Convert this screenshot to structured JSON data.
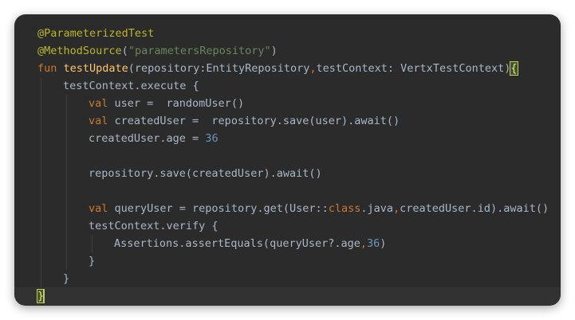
{
  "editor": {
    "lines": [
      {
        "indent": 0,
        "tokens": [
          {
            "t": "@ParameterizedTest",
            "c": "ann"
          }
        ]
      },
      {
        "indent": 0,
        "tokens": [
          {
            "t": "@MethodSource",
            "c": "ann"
          },
          {
            "t": "(",
            "c": ""
          },
          {
            "t": "\"parametersRepository\"",
            "c": "str"
          },
          {
            "t": ")",
            "c": ""
          }
        ]
      },
      {
        "indent": 0,
        "tokens": [
          {
            "t": "fun ",
            "c": "kw"
          },
          {
            "t": "testUpdate",
            "c": "fn"
          },
          {
            "t": "(repository:EntityRepository",
            "c": ""
          },
          {
            "t": ",",
            "c": "kw"
          },
          {
            "t": "testContext: VertxTestContext)",
            "c": ""
          },
          {
            "t": "{",
            "c": "brace-match"
          }
        ]
      },
      {
        "indent": 1,
        "tokens": [
          {
            "t": "testContext.execute {",
            "c": ""
          }
        ]
      },
      {
        "indent": 2,
        "tokens": [
          {
            "t": "val ",
            "c": "kw"
          },
          {
            "t": "user =  randomUser()",
            "c": ""
          }
        ]
      },
      {
        "indent": 2,
        "tokens": [
          {
            "t": "val ",
            "c": "kw"
          },
          {
            "t": "createdUser =  repository.save(user).await()",
            "c": ""
          }
        ]
      },
      {
        "indent": 2,
        "tokens": [
          {
            "t": "createdUser.age = ",
            "c": ""
          },
          {
            "t": "36",
            "c": "num"
          }
        ]
      },
      {
        "indent": 2,
        "tokens": []
      },
      {
        "indent": 2,
        "tokens": [
          {
            "t": "repository.save(createdUser).await()",
            "c": ""
          }
        ]
      },
      {
        "indent": 2,
        "tokens": []
      },
      {
        "indent": 2,
        "tokens": [
          {
            "t": "val ",
            "c": "kw"
          },
          {
            "t": "queryUser = repository.get(User::",
            "c": ""
          },
          {
            "t": "class",
            "c": "kw"
          },
          {
            "t": ".java",
            "c": ""
          },
          {
            "t": ",",
            "c": "kw"
          },
          {
            "t": "createdUser.id).await()",
            "c": ""
          }
        ]
      },
      {
        "indent": 2,
        "tokens": [
          {
            "t": "testContext.verify {",
            "c": ""
          }
        ]
      },
      {
        "indent": 3,
        "tokens": [
          {
            "t": "Assertions.assertEquals(queryUser?.age",
            "c": ""
          },
          {
            "t": ",",
            "c": "kw"
          },
          {
            "t": "36",
            "c": "num"
          },
          {
            "t": ")",
            "c": ""
          }
        ]
      },
      {
        "indent": 2,
        "tokens": [
          {
            "t": "}",
            "c": ""
          }
        ]
      },
      {
        "indent": 1,
        "tokens": [
          {
            "t": "}",
            "c": ""
          }
        ]
      },
      {
        "indent": 0,
        "tokens": [
          {
            "t": "}",
            "c": "brace-match"
          }
        ],
        "current": true,
        "caret": true
      }
    ]
  }
}
